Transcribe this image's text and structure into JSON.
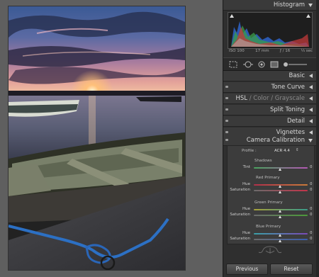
{
  "panel": {
    "histogram": {
      "title": "Histogram",
      "iso": "ISO 100",
      "focal": "17 mm",
      "aperture": "ƒ / 16",
      "shutter": "⅓ sec"
    },
    "sections": {
      "basic": "Basic",
      "tone_curve": "Tone Curve",
      "hsl": "HSL",
      "color": "Color",
      "grayscale": "Grayscale",
      "split_toning": "Split Toning",
      "detail": "Detail",
      "vignettes": "Vignettes",
      "camera_calibration": "Camera Calibration"
    },
    "calibration": {
      "profile_label": "Profile :",
      "profile_value": "ACR 4.4",
      "shadows": "Shadows",
      "tint_label": "Tint",
      "tint_value": "0",
      "red_primary": "Red Primary",
      "green_primary": "Green Primary",
      "blue_primary": "Blue Primary",
      "hue_label": "Hue",
      "saturation_label": "Saturation",
      "red_hue": "0",
      "red_sat": "0",
      "green_hue": "0",
      "green_sat": "0",
      "blue_hue": "0",
      "blue_sat": "0"
    },
    "buttons": {
      "previous": "Previous",
      "reset": "Reset"
    }
  },
  "colors": {
    "panel_bg": "#2f2f2f",
    "header_bg": "#3a3a3a",
    "red_track": "#b0304a",
    "green_track": "#4c9a3a",
    "blue_track": "#3a5fb0",
    "tint_track": "#5aa06a"
  }
}
